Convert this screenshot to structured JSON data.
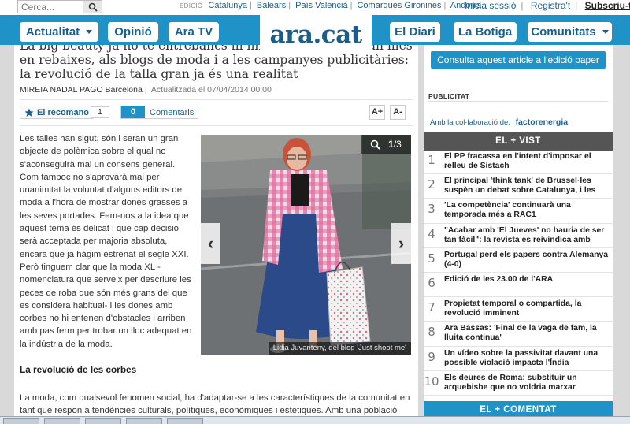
{
  "topbar": {
    "search_placeholder": "Cerca...",
    "editions_label": "EDICIÓ",
    "editions": [
      "Catalunya",
      "Balears",
      "País Valencià",
      "Comarques Gironines",
      "Andorra"
    ],
    "login": "Inicia sessió",
    "register": "Registra't",
    "subscribe": "Subscriu-t'hi"
  },
  "nav": {
    "logo": "ara.cat",
    "items": [
      "Actualitat",
      "Opinió",
      "Ara TV",
      "El Diari",
      "La Botiga",
      "Comunitats"
    ]
  },
  "article": {
    "headline": "La big beauty ja no té entrebancs ni impediments ni es fan més en rebaixes, als blogs de moda i a les campanyes publicitàries: la revolució de la talla gran ja és una realitat",
    "author": "MIREIA NADAL PAGO",
    "city": "Barcelona",
    "updated": "Actualitzada el 07/04/2014 00:00",
    "recommend_label": "El recomano",
    "recommend_count": "1",
    "comments_count": "0",
    "comments_label": "Comentaris",
    "font_increase": "A+",
    "font_decrease": "A-",
    "paragraph1": "Les talles han sigut, són i seran un gran objecte de polèmica sobre el qual no s'aconseguirà mai un consens general. Com tampoc no s'aprovarà mai per unanimitat la voluntat d'alguns editors de moda a l'hora de mostrar dones grasses a les seves portades. Fem-nos a la idea que aquest tema és delicat i que cap decisió serà acceptada per majoria absoluta, encara que ja hàgim estrenat el segle XXI. Però tinguem clar que la moda XL -nomenclatura que serveix per descriure les peces de roba que són més grans del que es considera habitual- i les dones amb corbes no hi entenen d'obstacles i arriben amb pas ferm per trobar un lloc adequat en la indústria de la moda.",
    "subheading": "La revolució de les corbes",
    "paragraph2": "La moda, com qualsevol fenomen social, ha d'adaptar-se a les característiques de la comunitat en tant que respon a tendències culturals, polítiques, econòmiques i estètiques. Amb una població que",
    "photo_counter_current": "1",
    "photo_counter_total": "/3",
    "photo_caption": "Lidia Juvanteny, del blog 'Just shoot me'"
  },
  "sidebar": {
    "paper_button": "Consulta aquest article a l'edició paper",
    "publicity_label": "PUBLICITAT",
    "collab_label": "Amb la col·laboració de:",
    "collab_brand": "factorenergia",
    "most_viewed_title": "EL + VIST",
    "most_viewed": [
      {
        "num": "1",
        "text": "El PP fracassa en l'intent d'imposar el relleu de Sistach"
      },
      {
        "num": "2",
        "text": "El principal 'think tank' de Brussel·les suspèn un debat sobre Catalunya, i les"
      },
      {
        "num": "3",
        "text": "'La competència' continuarà una temporada més a RAC1"
      },
      {
        "num": "4",
        "text": "\"Acabar amb 'El Jueves' no hauria de ser tan fàcil\": la revista es reivindica amb"
      },
      {
        "num": "5",
        "text": "Portugal perd els papers contra Alemanya (4-0)"
      },
      {
        "num": "6",
        "text": "Edició de les 23.00 de l'ARA"
      },
      {
        "num": "7",
        "text": "Propietat temporal o compartida, la revolució imminent"
      },
      {
        "num": "8",
        "text": "Ara Bassas: 'Final de la vaga de fam, la lluita continua'"
      },
      {
        "num": "9",
        "text": "Un vídeo sobre la passivitat davant una possible violació impacta l'Índia"
      },
      {
        "num": "10",
        "text": "Els deures de Roma: substituir un arquebisbe que no voldria marxar"
      }
    ],
    "most_commented_title": "EL + COMENTAT"
  },
  "colors": {
    "nav_blue": "#1f93c8",
    "link_blue": "#1b5e8c",
    "dark_tab": "#555555"
  }
}
